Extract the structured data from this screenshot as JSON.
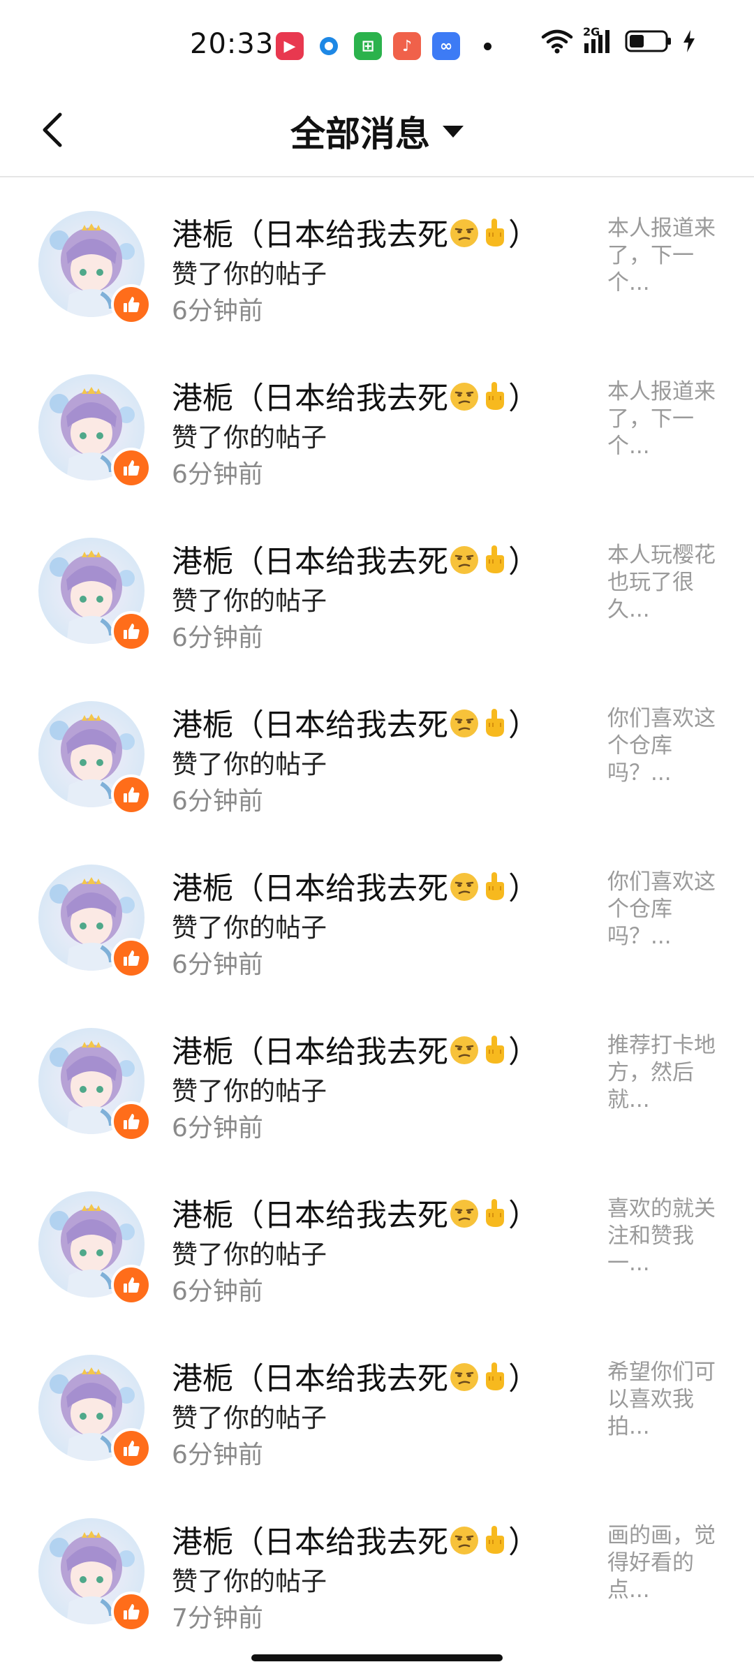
{
  "status_bar": {
    "time": "20:33",
    "apps": [
      {
        "icon": "video-app-icon",
        "color": "#e8384f",
        "glyph": "▶"
      },
      {
        "icon": "browser-app-icon",
        "color": "#ffffff",
        "glyph": ""
      },
      {
        "icon": "store-app-icon",
        "color": "#2bb24c",
        "glyph": "⊞"
      },
      {
        "icon": "music-app-icon",
        "color": "#f0614a",
        "glyph": "♪"
      },
      {
        "icon": "cloud-app-icon",
        "color": "#3d7bf5",
        "glyph": "∞"
      }
    ],
    "network_label": "2G"
  },
  "header": {
    "title": "全部消息"
  },
  "colors": {
    "like_badge": "#ff6d1a",
    "secondary_text": "#8a8a8a"
  },
  "notifications": [
    {
      "user": "港栀（日本给我去死",
      "trailing": "）",
      "action": "赞了你的帖子",
      "time": "6分钟前",
      "preview": "本人报道来了，下一个..."
    },
    {
      "user": "港栀（日本给我去死",
      "trailing": "）",
      "action": "赞了你的帖子",
      "time": "6分钟前",
      "preview": "本人报道来了，下一个..."
    },
    {
      "user": "港栀（日本给我去死",
      "trailing": "）",
      "action": "赞了你的帖子",
      "time": "6分钟前",
      "preview": "本人玩樱花也玩了很久..."
    },
    {
      "user": "港栀（日本给我去死",
      "trailing": "）",
      "action": "赞了你的帖子",
      "time": "6分钟前",
      "preview": "你们喜欢这个仓库吗？..."
    },
    {
      "user": "港栀（日本给我去死",
      "trailing": "）",
      "action": "赞了你的帖子",
      "time": "6分钟前",
      "preview": "你们喜欢这个仓库吗？..."
    },
    {
      "user": "港栀（日本给我去死",
      "trailing": "）",
      "action": "赞了你的帖子",
      "time": "6分钟前",
      "preview": "推荐打卡地方，然后就..."
    },
    {
      "user": "港栀（日本给我去死",
      "trailing": "）",
      "action": "赞了你的帖子",
      "time": "6分钟前",
      "preview": "喜欢的就关注和赞我一..."
    },
    {
      "user": "港栀（日本给我去死",
      "trailing": "）",
      "action": "赞了你的帖子",
      "time": "6分钟前",
      "preview": "希望你们可以喜欢我拍..."
    },
    {
      "user": "港栀（日本给我去死",
      "trailing": "）",
      "action": "赞了你的帖子",
      "time": "7分钟前",
      "preview": "画的画，觉得好看的点..."
    }
  ]
}
